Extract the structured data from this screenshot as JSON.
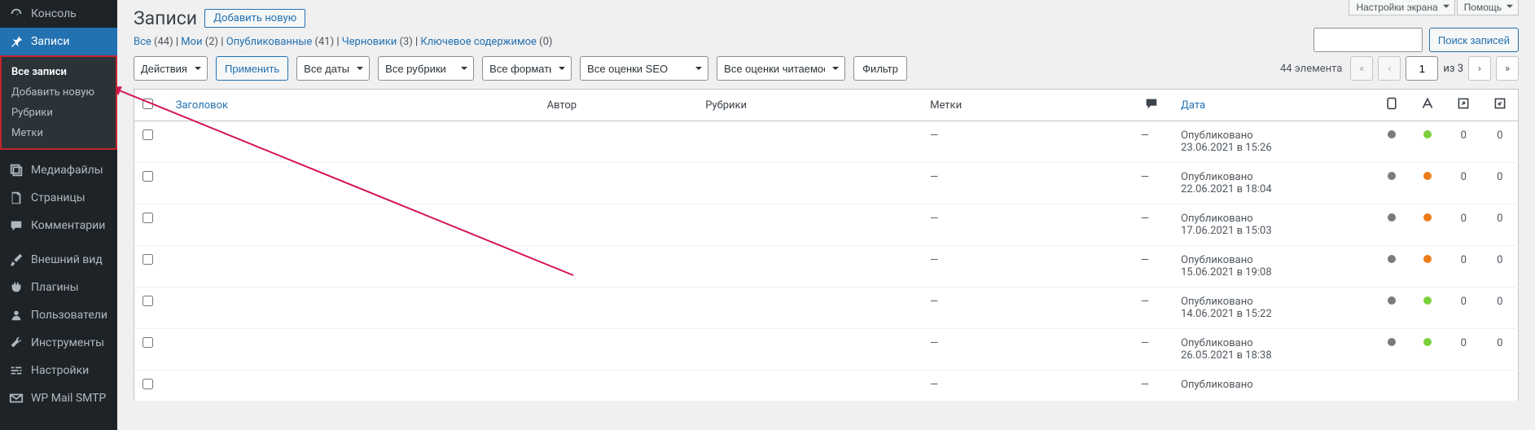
{
  "screen_options": {
    "settings": "Настройки экрана",
    "help": "Помощь"
  },
  "sidebar": {
    "items": [
      {
        "label": "Консоль"
      },
      {
        "label": "Записи"
      },
      {
        "label": "Медиафайлы"
      },
      {
        "label": "Страницы"
      },
      {
        "label": "Комментарии"
      },
      {
        "label": "Внешний вид"
      },
      {
        "label": "Плагины"
      },
      {
        "label": "Пользователи"
      },
      {
        "label": "Инструменты"
      },
      {
        "label": "Настройки"
      },
      {
        "label": "WP Mail SMTP"
      }
    ],
    "submenu": [
      {
        "label": "Все записи"
      },
      {
        "label": "Добавить новую"
      },
      {
        "label": "Рубрики"
      },
      {
        "label": "Метки"
      }
    ]
  },
  "page": {
    "title": "Записи",
    "add_new": "Добавить новую"
  },
  "filters_links": {
    "all": "Все",
    "all_count": "(44)",
    "mine": "Мои",
    "mine_count": "(2)",
    "published": "Опубликованные",
    "published_count": "(41)",
    "drafts": "Черновики",
    "drafts_count": "(3)",
    "key": "Ключевое содержимое",
    "key_count": "(0)"
  },
  "bulk": {
    "actions": "Действия",
    "apply": "Применить"
  },
  "filters": {
    "dates": "Все даты",
    "cats": "Все рубрики",
    "formats": "Все форматы",
    "seo": "Все оценки SEO",
    "readability": "Все оценки читаемости",
    "filter_btn": "Фильтр"
  },
  "search": {
    "button": "Поиск записей"
  },
  "pagination": {
    "items": "44 элемента",
    "first": "«",
    "prev": "‹",
    "current": "1",
    "of": "из 3",
    "next": "›",
    "last": "»"
  },
  "columns": {
    "title": "Заголовок",
    "author": "Автор",
    "categories": "Рубрики",
    "tags": "Метки",
    "date": "Дата"
  },
  "rows": [
    {
      "status": "Опубликовано",
      "date": "23.06.2021 в 15:26",
      "c1": "grey",
      "c2": "green",
      "v1": "0",
      "v2": "0"
    },
    {
      "status": "Опубликовано",
      "date": "22.06.2021 в 18:04",
      "c1": "grey",
      "c2": "orange",
      "v1": "0",
      "v2": "0"
    },
    {
      "status": "Опубликовано",
      "date": "17.06.2021 в 15:03",
      "c1": "grey",
      "c2": "orange",
      "v1": "0",
      "v2": "0"
    },
    {
      "status": "Опубликовано",
      "date": "15.06.2021 в 19:08",
      "c1": "grey",
      "c2": "orange",
      "v1": "0",
      "v2": "0"
    },
    {
      "status": "Опубликовано",
      "date": "14.06.2021 в 15:22",
      "c1": "grey",
      "c2": "green",
      "v1": "0",
      "v2": "0"
    },
    {
      "status": "Опубликовано",
      "date": "26.05.2021 в 18:38",
      "c1": "grey",
      "c2": "green",
      "v1": "0",
      "v2": "0"
    },
    {
      "status": "Опубликовано",
      "date": "",
      "c1": "",
      "c2": "",
      "v1": "",
      "v2": ""
    }
  ]
}
